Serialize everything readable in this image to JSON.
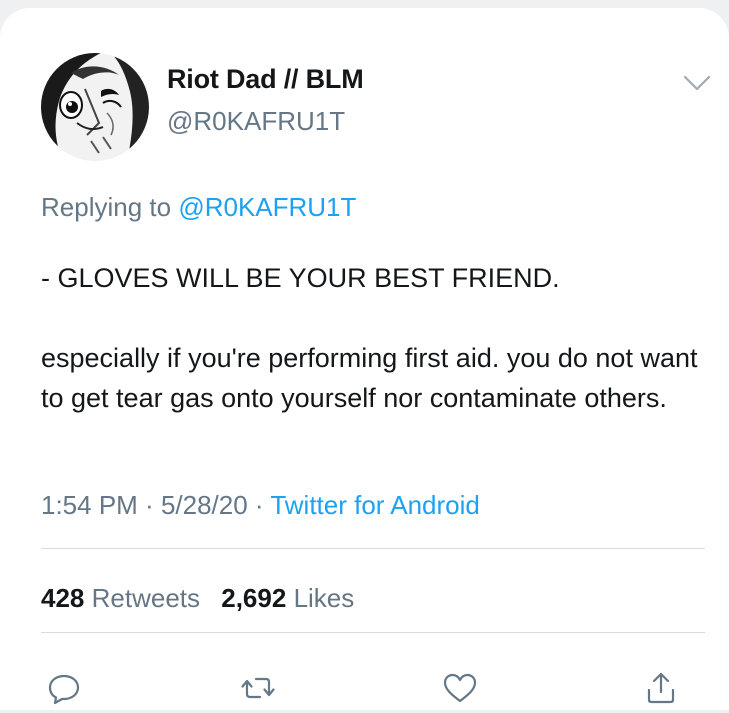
{
  "tweet": {
    "author": {
      "display_name": "Riot Dad // BLM",
      "handle": "@R0KAFRU1T"
    },
    "replying_prefix": "Replying to",
    "replying_to": "@R0KAFRU1T",
    "text_lines": [
      "- GLOVES WILL BE YOUR BEST FRIEND.",
      "especially if you're performing first aid. you do not want to get tear gas onto yourself nor contaminate others."
    ],
    "time": "1:54 PM",
    "separator": " · ",
    "date": "5/28/20",
    "source": "Twitter for Android"
  },
  "stats": {
    "retweets_count": "428",
    "retweets_label": "Retweets",
    "likes_count": "2,692",
    "likes_label": "Likes"
  },
  "icons": {
    "menu": "chevron-down-icon",
    "reply": "speech-bubble-icon",
    "retweet": "retweet-arrows-icon",
    "like": "heart-icon",
    "share": "share-upload-icon"
  },
  "colors": {
    "link_blue": "#1da1f2",
    "secondary_gray": "#657786",
    "text_dark": "#14171a"
  }
}
